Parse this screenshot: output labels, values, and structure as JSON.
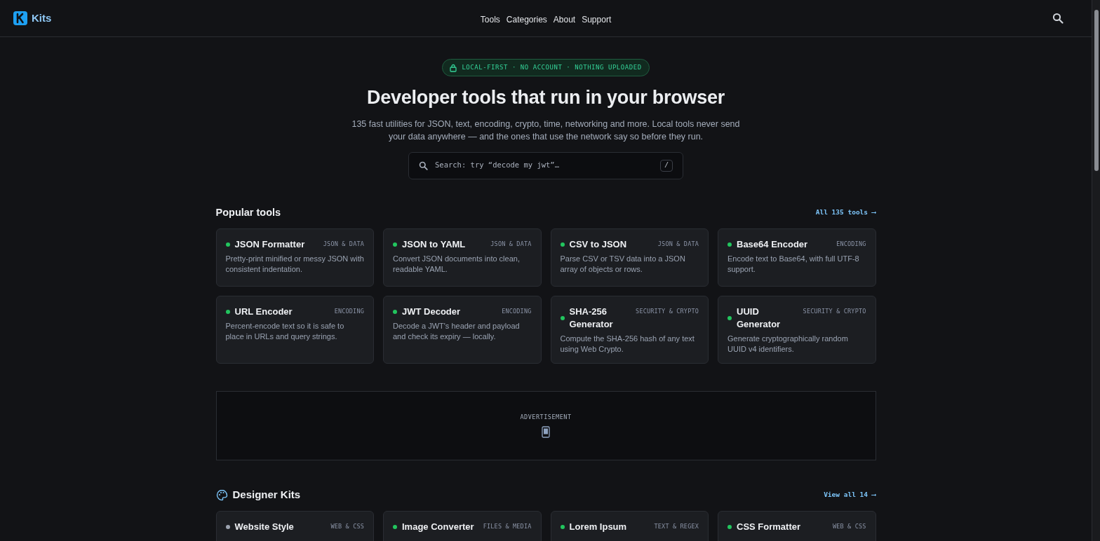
{
  "header": {
    "logo_text": "Kits",
    "nav": [
      {
        "label": "Tools"
      },
      {
        "label": "Categories"
      },
      {
        "label": "About"
      },
      {
        "label": "Support"
      }
    ]
  },
  "hero": {
    "badge": "LOCAL-FIRST · NO ACCOUNT · NOTHING UPLOADED",
    "title": "Developer tools that run in your browser",
    "subtitle": "135 fast utilities for JSON, text, encoding, crypto, time, networking and more. Local tools never send your data anywhere — and the ones that use the network say so before they run.",
    "search": {
      "placeholder": "Search: try “decode my jwt”…",
      "shortcut": "/"
    }
  },
  "sections": [
    {
      "title": "Popular tools",
      "icon": false,
      "link": "All 135 tools ⟶",
      "tools": [
        {
          "name": "JSON Formatter",
          "tag": "JSON & DATA",
          "color": "#22c55e",
          "description": "Pretty-print minified or messy JSON with consistent indentation."
        },
        {
          "name": "JSON to YAML",
          "tag": "JSON & DATA",
          "color": "#22c55e",
          "description": "Convert JSON documents into clean, readable YAML."
        },
        {
          "name": "CSV to JSON",
          "tag": "JSON & DATA",
          "color": "#22c55e",
          "description": "Parse CSV or TSV data into a JSON array of objects or rows."
        },
        {
          "name": "Base64 Encoder",
          "tag": "ENCODING",
          "color": "#22c55e",
          "description": "Encode text to Base64, with full UTF-8 support."
        },
        {
          "name": "URL Encoder",
          "tag": "ENCODING",
          "color": "#22c55e",
          "description": "Percent-encode text so it is safe to place in URLs and query strings."
        },
        {
          "name": "JWT Decoder",
          "tag": "ENCODING",
          "color": "#22c55e",
          "description": "Decode a JWT's header and payload and check its expiry — locally."
        },
        {
          "name": "SHA-256 Generator",
          "tag": "SECURITY & CRYPTO",
          "color": "#22c55e",
          "description": "Compute the SHA-256 hash of any text using Web Crypto."
        },
        {
          "name": "UUID Generator",
          "tag": "SECURITY & CRYPTO",
          "color": "#22c55e",
          "description": "Generate cryptographically random UUID v4 identifiers."
        }
      ]
    },
    {
      "ad": "ADVERTISEMENT"
    },
    {
      "title": "Designer Kits",
      "icon": true,
      "link": "View all 14 ⟶",
      "tools": [
        {
          "name": "Website Style",
          "tag": "WEB & CSS",
          "color": "#9ca3af"
        },
        {
          "name": "Image Converter",
          "tag": "FILES & MEDIA",
          "color": "#22c55e"
        },
        {
          "name": "Lorem Ipsum",
          "tag": "TEXT & REGEX",
          "color": "#22c55e"
        },
        {
          "name": "CSS Formatter",
          "tag": "WEB & CSS",
          "color": "#22c55e"
        }
      ]
    }
  ]
}
